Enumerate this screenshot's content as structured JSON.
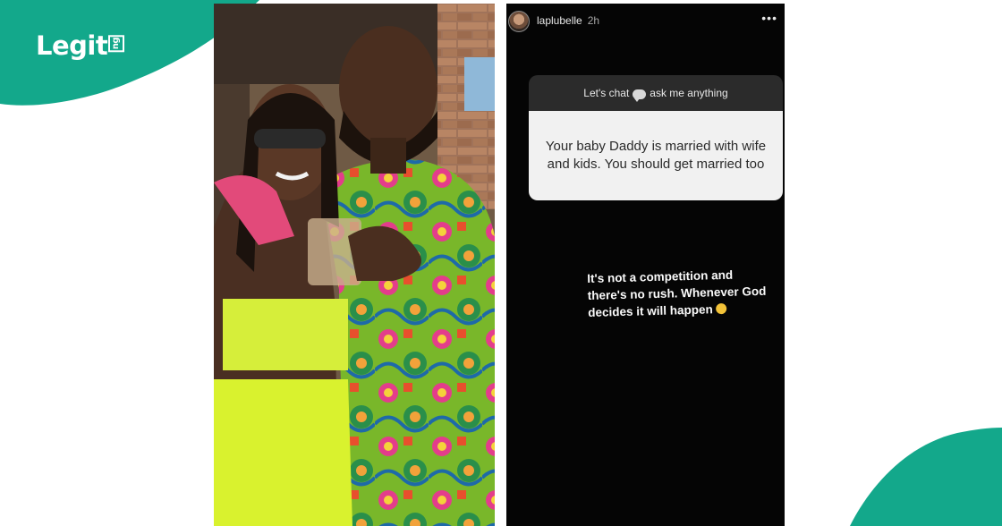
{
  "brand": {
    "logo_text": "Legit",
    "logo_suffix": "ng",
    "accent_color": "#13a88b"
  },
  "photo": {
    "subject": "couple-photo"
  },
  "story": {
    "username": "laplubelle",
    "time": "2h",
    "menu": "•••",
    "question_header": "Let's chat",
    "question_header_suffix": "ask me anything",
    "question_text": "Your baby Daddy is married with wife and kids. You should get married too",
    "answer_text": "It's not a competition and there's no rush. Whenever God decides it will happen"
  }
}
